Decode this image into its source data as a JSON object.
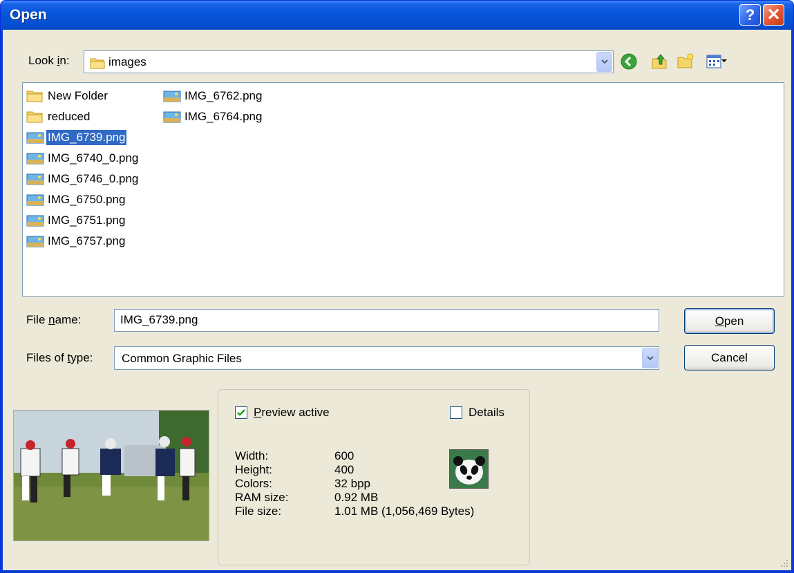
{
  "window": {
    "title": "Open"
  },
  "toolbar": {
    "lookin_label_pre": "Look ",
    "lookin_label_key": "i",
    "lookin_label_post": "n:",
    "lookin_value": "images",
    "icons": [
      "back-icon",
      "up-folder-icon",
      "new-folder-icon",
      "view-menu-icon"
    ]
  },
  "files": [
    {
      "name": "New Folder",
      "type": "folder"
    },
    {
      "name": "reduced",
      "type": "folder"
    },
    {
      "name": "IMG_6739.png",
      "type": "image",
      "selected": true
    },
    {
      "name": "IMG_6740_0.png",
      "type": "image"
    },
    {
      "name": "IMG_6746_0.png",
      "type": "image"
    },
    {
      "name": "IMG_6750.png",
      "type": "image"
    },
    {
      "name": "IMG_6751.png",
      "type": "image"
    },
    {
      "name": "IMG_6757.png",
      "type": "image"
    },
    {
      "name": "IMG_6762.png",
      "type": "image"
    },
    {
      "name": "IMG_6764.png",
      "type": "image"
    }
  ],
  "filename": {
    "label_pre": "File ",
    "label_key": "n",
    "label_post": "ame:",
    "value": "IMG_6739.png"
  },
  "filetype": {
    "label_pre": "Files of ",
    "label_key": "t",
    "label_post": "ype:",
    "value": "Common Graphic Files"
  },
  "buttons": {
    "open_key": "O",
    "open_rest": "pen",
    "cancel": "Cancel"
  },
  "preview": {
    "preview_active_key": "P",
    "preview_active_rest": "review active",
    "preview_active_checked": true,
    "details_label": "Details",
    "details_checked": false,
    "info": [
      {
        "key": "Width:",
        "value": "600"
      },
      {
        "key": "Height:",
        "value": "400"
      },
      {
        "key": "Colors:",
        "value": "32 bpp"
      },
      {
        "key": "RAM size:",
        "value": "0.92 MB"
      },
      {
        "key": "File size:",
        "value": "1.01 MB (1,056,469 Bytes)"
      }
    ]
  },
  "colors": {
    "titlebar": "#0655d8",
    "selection": "#316ac5",
    "dialog_bg": "#ece9d8"
  }
}
